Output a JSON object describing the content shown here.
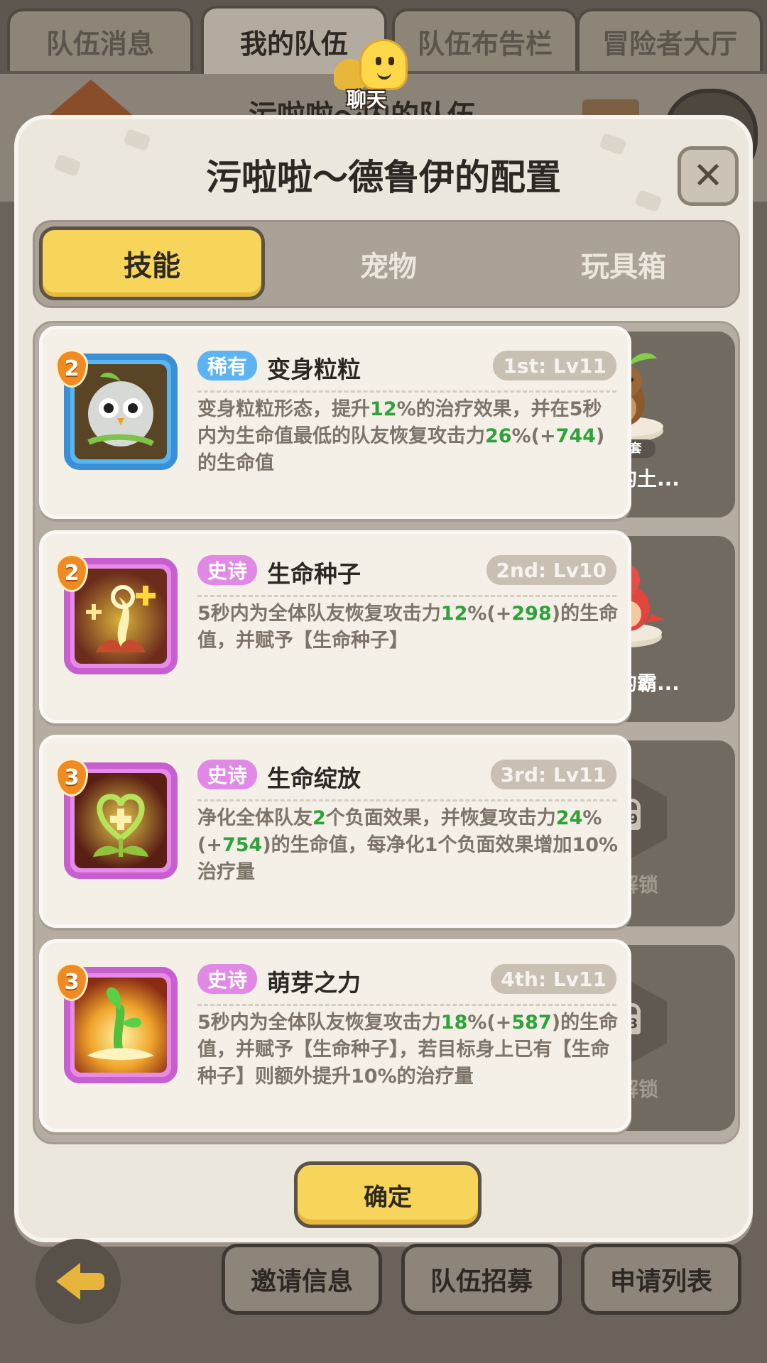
{
  "top_tabs": [
    "队伍消息",
    "我的队伍",
    "队伍布告栏",
    "冒险者大厅"
  ],
  "background_title": "污啦啦～内的队伍",
  "chat_label": "聊天",
  "modal": {
    "title": "污啦啦～德鲁伊的配置",
    "close": "✕",
    "tabs": [
      "技能",
      "宠物",
      "玩具箱"
    ],
    "active_tab": "技能"
  },
  "skills": [
    {
      "level": "2",
      "rarity": "稀有",
      "name": "变身粒粒",
      "slot": "1st: Lv11",
      "desc": [
        {
          "t": "变身粒粒形态，提升"
        },
        {
          "t": "12",
          "hl": true
        },
        {
          "t": "%的治疗效果，并在5秒内为生命值最低的队友恢复攻击力"
        },
        {
          "t": "26",
          "hl": true
        },
        {
          "t": "%(+"
        },
        {
          "t": "744",
          "hl": true
        },
        {
          "t": ")的生命值"
        }
      ]
    },
    {
      "level": "2",
      "rarity": "史诗",
      "name": "生命种子",
      "slot": "2nd: Lv10",
      "desc": [
        {
          "t": "5秒内为全体队友恢复攻击力"
        },
        {
          "t": "12",
          "hl": true
        },
        {
          "t": "%(+"
        },
        {
          "t": "298",
          "hl": true
        },
        {
          "t": ")的生命值，并赋予【生命种子】"
        }
      ]
    },
    {
      "level": "3",
      "rarity": "史诗",
      "name": "生命绽放",
      "slot": "3rd: Lv11",
      "desc": [
        {
          "t": "净化全体队友"
        },
        {
          "t": "2",
          "hl": true
        },
        {
          "t": "个负面效果，并恢复攻击力"
        },
        {
          "t": "24",
          "hl": true
        },
        {
          "t": "%(+"
        },
        {
          "t": "754",
          "hl": true
        },
        {
          "t": ")的生命值，每净化1个负面效果增加10%治疗量"
        }
      ]
    },
    {
      "level": "3",
      "rarity": "史诗",
      "name": "萌芽之力",
      "slot": "4th: Lv11",
      "desc": [
        {
          "t": "5秒内为全体队友恢复攻击力"
        },
        {
          "t": "18",
          "hl": true
        },
        {
          "t": "%(+"
        },
        {
          "t": "587",
          "hl": true
        },
        {
          "t": ")的生命值，并赋予【生命种子】，若目标身上已有【生命种子】则额外提升10%的治疗量"
        }
      ]
    }
  ],
  "side_items": [
    {
      "type": "pet",
      "name": "快乐的土...",
      "tag": "三件套"
    },
    {
      "type": "pet",
      "name": "进击的霸..."
    },
    {
      "type": "locked",
      "level": "59",
      "label": "未解锁"
    },
    {
      "type": "locked",
      "level": "63",
      "label": "未解锁"
    }
  ],
  "confirm": "确定",
  "bottom_buttons": [
    "邀请信息",
    "队伍招募",
    "申请列表"
  ],
  "colors": {
    "accent_yellow": "#f7d55a",
    "rare_blue": "#5eb4f3",
    "epic_purple": "#e08ae6",
    "highlight_green": "#2fa23a",
    "level_orange": "#f08a22"
  }
}
